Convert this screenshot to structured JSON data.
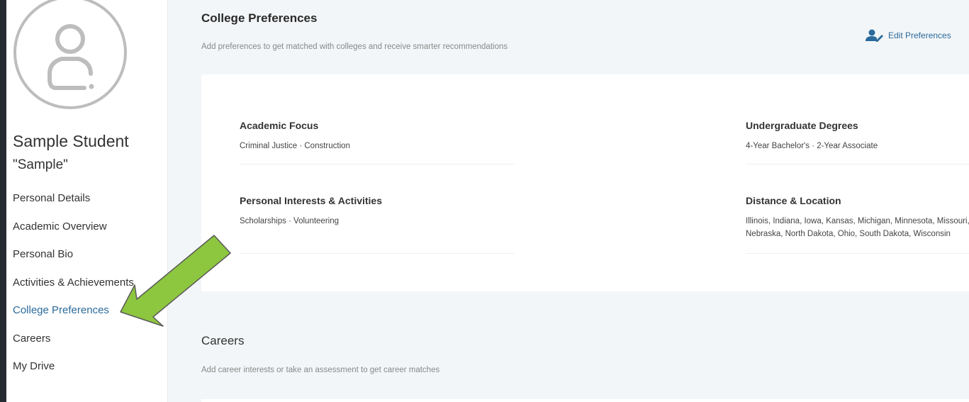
{
  "sidebar": {
    "student_name": "Sample Student",
    "student_nickname": "\"Sample\"",
    "nav": [
      {
        "label": "Personal Details"
      },
      {
        "label": "Academic Overview"
      },
      {
        "label": "Personal Bio"
      },
      {
        "label": "Activities & Achievements"
      },
      {
        "label": "College Preferences",
        "active": true
      },
      {
        "label": "Careers"
      },
      {
        "label": "My Drive"
      }
    ]
  },
  "college_preferences": {
    "title": "College Preferences",
    "subtitle": "Add preferences to get matched with colleges and receive smarter recommendations",
    "edit_label": "Edit Preferences",
    "items": {
      "academic_focus": {
        "label": "Academic Focus",
        "value": "Criminal Justice · Construction"
      },
      "undergraduate_degrees": {
        "label": "Undergraduate Degrees",
        "value": "4-Year Bachelor's · 2-Year Associate"
      },
      "personal_interests": {
        "label": "Personal Interests & Activities",
        "value": "Scholarships · Volunteering"
      },
      "distance_location": {
        "label": "Distance & Location",
        "value_line1": "Illinois, Indiana, Iowa, Kansas, Michigan, Minnesota, Missouri,",
        "value_line2": "Nebraska, North Dakota, Ohio, South Dakota, Wisconsin"
      }
    }
  },
  "careers": {
    "title": "Careers",
    "subtitle": "Add career interests or take an assessment to get career matches"
  },
  "icons": {
    "avatar": "user-outline-icon",
    "edit": "user-edit-icon",
    "annotation": "arrow-annotation"
  },
  "colors": {
    "accent": "#2b6a9b",
    "page_bg": "#1f2228",
    "main_bg": "#f3f6f8",
    "arrow_fill": "#8dc63f",
    "arrow_stroke": "#5a5a5a"
  }
}
